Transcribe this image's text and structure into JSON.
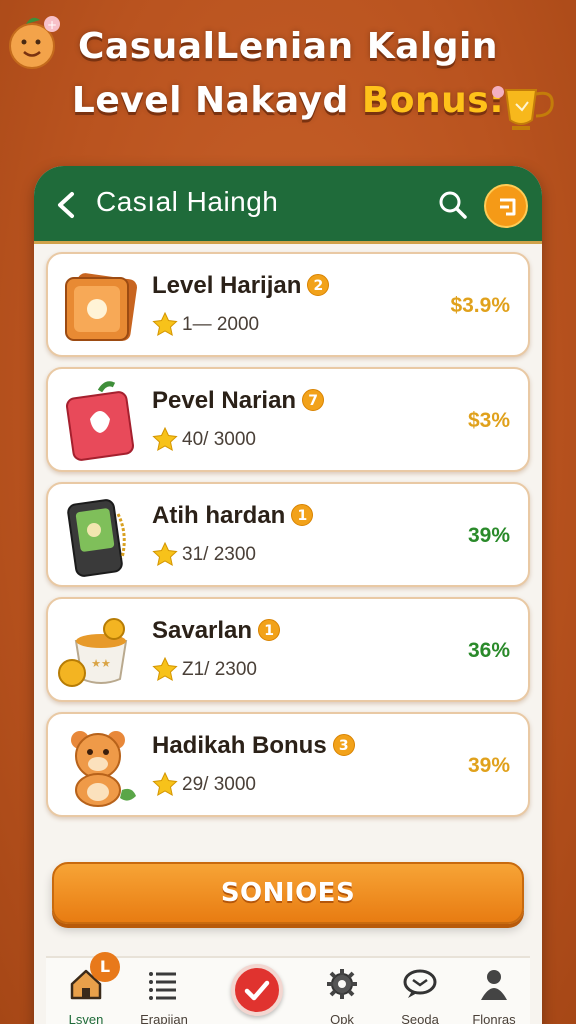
{
  "banner": {
    "line1": "CasualLenian Kalgin",
    "line2_prefix": "Level Nakayd",
    "line2_highlight": "Bonus:"
  },
  "header": {
    "title": "Casıal Haingh",
    "accent_color": "#1f6b3a"
  },
  "items": [
    {
      "title": "Level Harijan",
      "badge": "2",
      "progress": "1— 2000",
      "value": "$3.9%",
      "value_color": "#e0a11c",
      "art": "photo-stack-icon"
    },
    {
      "title": "Pevel Narian",
      "badge": "7",
      "progress": "40/ 3000",
      "value": "$3%",
      "value_color": "#e0a11c",
      "art": "red-journal-icon"
    },
    {
      "title": "Atih hardan",
      "badge": "1",
      "progress": "31/ 2300",
      "value": "39%",
      "value_color": "#2a8a2a",
      "art": "phone-icon"
    },
    {
      "title": "Savarlan",
      "badge": "1",
      "progress": "Z1/ 2300",
      "value": "36%",
      "value_color": "#2a8a2a",
      "art": "coin-cup-icon"
    },
    {
      "title": "Hadikah Bonus",
      "badge": "3",
      "progress": "29/ 3000",
      "value": "39%",
      "value_color": "#e0a11c",
      "art": "teddy-bear-icon"
    }
  ],
  "cta": {
    "label": "SONIOES"
  },
  "tabs": [
    {
      "label": "Lsven",
      "badge": "L",
      "icon": "home-icon"
    },
    {
      "label": "Erapiian",
      "icon": "list-icon"
    },
    {
      "label": "",
      "icon": "check-icon"
    },
    {
      "label": "Opk",
      "icon": "gear-icon"
    },
    {
      "label": "Seoda",
      "icon": "message-icon"
    },
    {
      "label": "Flonras",
      "icon": "user-icon"
    }
  ]
}
